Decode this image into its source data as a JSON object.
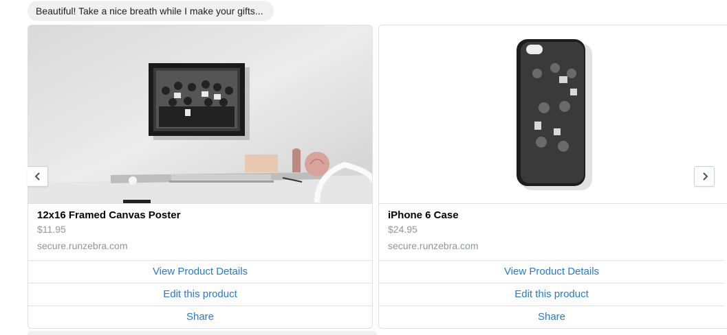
{
  "message": {
    "text": "Beautiful! Take a nice breath while I make your gifts..."
  },
  "carousel": {
    "prev_icon": "chevron-left-icon",
    "next_icon": "chevron-right-icon",
    "cards": [
      {
        "title": "12x16 Framed Canvas Poster",
        "price": "$11.95",
        "domain": "secure.runzebra.com",
        "buttons": [
          "View Product Details",
          "Edit this product",
          "Share"
        ]
      },
      {
        "title": "iPhone 6 Case",
        "price": "$24.95",
        "domain": "secure.runzebra.com",
        "buttons": [
          "View Product Details",
          "Edit this product",
          "Share"
        ]
      }
    ]
  },
  "colors": {
    "link": "#2479d7",
    "muted": "#90949c",
    "bubble": "#f1f0f0",
    "border": "#dddfe2"
  }
}
